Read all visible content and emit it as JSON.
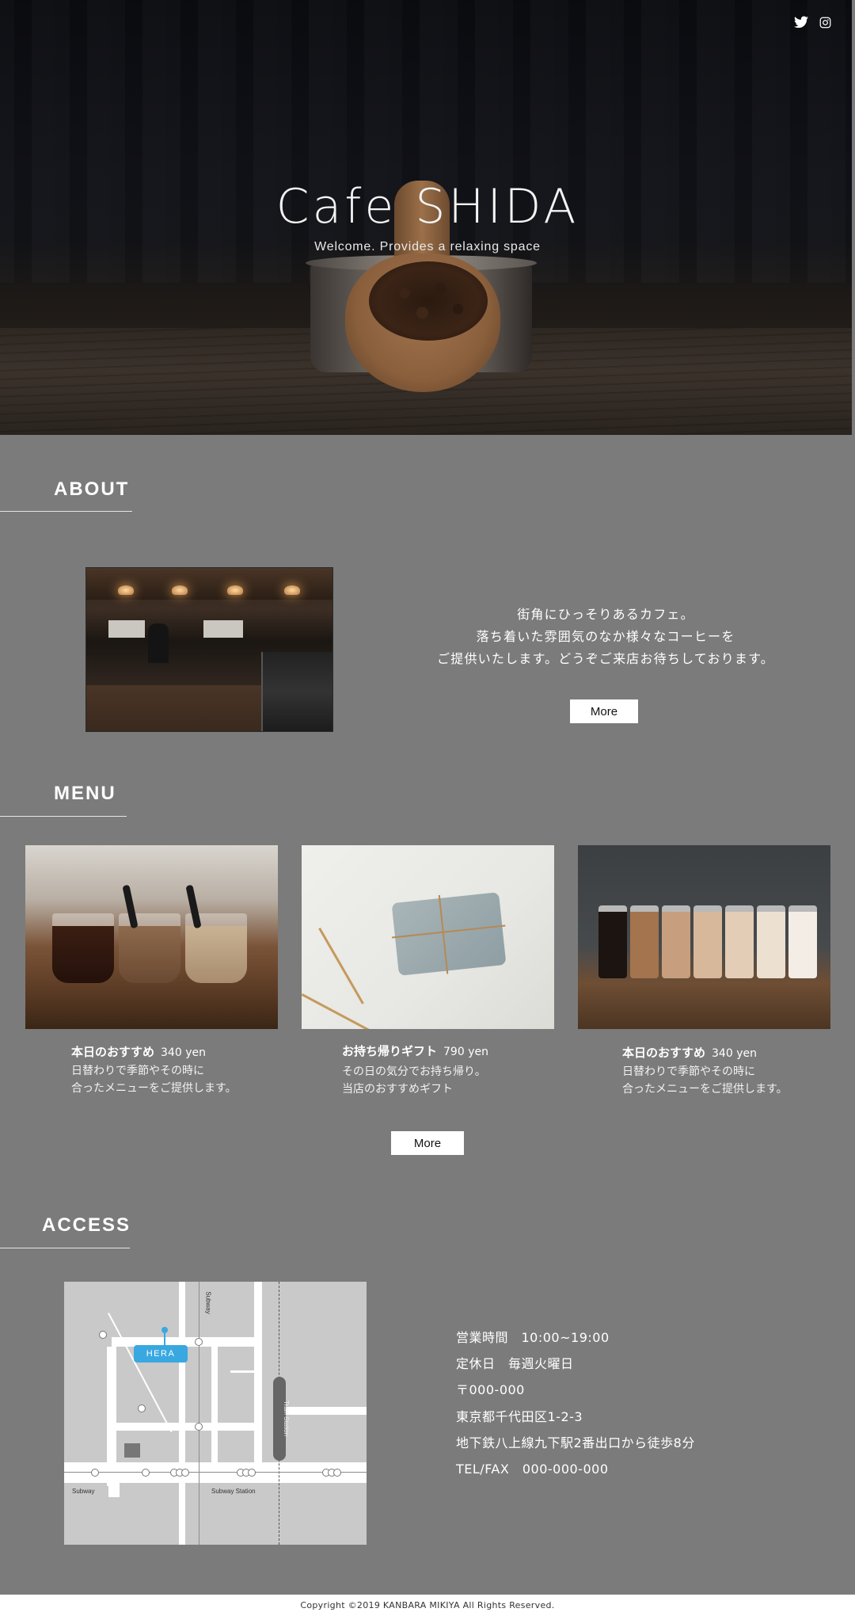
{
  "hero": {
    "title": "Cafe SHIDA",
    "subtitle": "Welcome. Provides a relaxing space",
    "social": [
      "twitter-icon",
      "instagram-icon"
    ]
  },
  "about": {
    "heading": "ABOUT",
    "lines": [
      "街角にひっそりあるカフェ。",
      "落ち着いた雰囲気のなか様々なコーヒーを",
      "ご提供いたします。どうぞご来店お待ちしております。"
    ],
    "more_label": "More"
  },
  "menu": {
    "heading": "MENU",
    "items": [
      {
        "title": "本日のおすすめ",
        "price": "340 yen",
        "desc": "日替わりで季節やその時に\n合ったメニューをご提供します。"
      },
      {
        "title": "お持ち帰りギフト",
        "price": "790 yen",
        "desc": "その日の気分でお持ち帰り。\n当店のおすすめギフト"
      },
      {
        "title": "本日のおすすめ",
        "price": "340 yen",
        "desc": "日替わりで季節やその時に\n合ったメニューをご提供します。"
      }
    ],
    "more_label": "More"
  },
  "access": {
    "heading": "ACCESS",
    "map": {
      "marker": "HERA",
      "labels": {
        "subway_v": "Subway",
        "train_station": "Train Station",
        "subway_h": "Subway",
        "subway_station": "Subway Station"
      }
    },
    "info": [
      "営業時間　10:00~19:00",
      "定休日　毎週火曜日",
      "〒000-000",
      "東京都千代田区1-2-3",
      "地下鉄八上線九下駅2番出口から徒歩8分",
      "TEL/FAX　000-000-000"
    ]
  },
  "footer": {
    "copyright": "Copyright ©2019 KANBARA MIKIYA All Rights Reserved."
  },
  "colors": {
    "background": "#7b7b7b",
    "marker": "#39a8e0"
  }
}
